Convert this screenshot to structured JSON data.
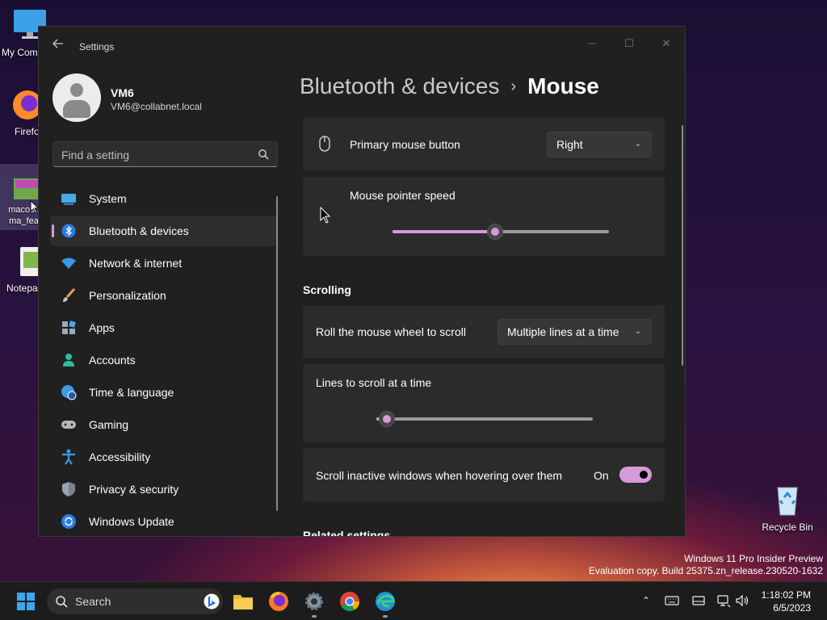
{
  "desktop": {
    "icons": [
      {
        "label": "My Com"
      },
      {
        "label": "Firefo"
      },
      {
        "label": "macos...\nma_feat"
      },
      {
        "label": "Notepa"
      },
      {
        "label": "Recycle Bin"
      }
    ]
  },
  "window": {
    "title": "Settings",
    "controls": {
      "minimize": "─",
      "maximize": "☐",
      "close": "✕"
    }
  },
  "profile": {
    "name": "VM6",
    "email": "VM6@collabnet.local"
  },
  "search": {
    "placeholder": "Find a setting",
    "value": ""
  },
  "nav": {
    "items": [
      {
        "label": "System",
        "icon": "monitor-icon"
      },
      {
        "label": "Bluetooth & devices",
        "icon": "bluetooth-icon",
        "active": true
      },
      {
        "label": "Network & internet",
        "icon": "wifi-icon"
      },
      {
        "label": "Personalization",
        "icon": "brush-icon"
      },
      {
        "label": "Apps",
        "icon": "apps-icon"
      },
      {
        "label": "Accounts",
        "icon": "person-icon"
      },
      {
        "label": "Time & language",
        "icon": "globe-clock-icon"
      },
      {
        "label": "Gaming",
        "icon": "gamepad-icon"
      },
      {
        "label": "Accessibility",
        "icon": "accessibility-icon"
      },
      {
        "label": "Privacy & security",
        "icon": "shield-icon"
      },
      {
        "label": "Windows Update",
        "icon": "refresh-icon"
      }
    ]
  },
  "breadcrumb": {
    "parent": "Bluetooth & devices",
    "separator": "›",
    "current": "Mouse"
  },
  "settings": {
    "primary_button": {
      "label": "Primary mouse button",
      "value": "Right"
    },
    "pointer_speed": {
      "label": "Mouse pointer speed",
      "level": 0.475
    },
    "scrolling_section": "Scrolling",
    "roll_wheel": {
      "label": "Roll the mouse wheel to scroll",
      "value": "Multiple lines at a time"
    },
    "lines_to_scroll": {
      "label": "Lines to scroll at a time",
      "level": 0.05
    },
    "scroll_inactive": {
      "label": "Scroll inactive windows when hovering over them",
      "state": "On"
    },
    "related_section": "Related settings"
  },
  "watermark": {
    "line1": "Windows 11 Pro Insider Preview",
    "line2": "Evaluation copy. Build 25375.zn_release.230520-1632"
  },
  "taskbar": {
    "search_label": "Search",
    "apps": [
      "file-explorer-icon",
      "firefox-icon",
      "settings-icon",
      "chrome-icon",
      "edge-icon"
    ],
    "time": "1:18:02 PM",
    "date": "6/5/2023"
  },
  "colors": {
    "accent": "#d69ad9",
    "window_bg": "#202020",
    "card_bg": "#2b2b2b"
  }
}
